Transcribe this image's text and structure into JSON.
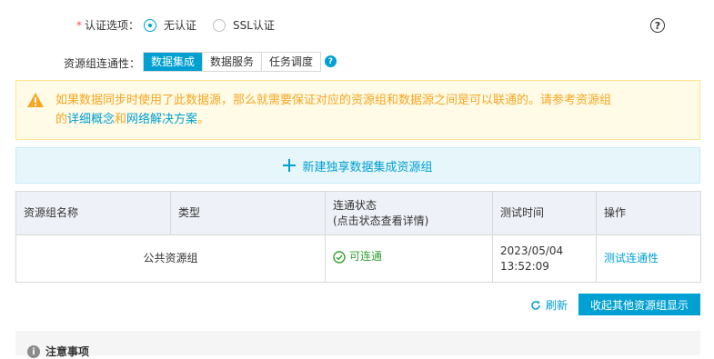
{
  "auth": {
    "required_mark": "*",
    "label": "认证选项：",
    "options": [
      {
        "label": "无认证",
        "checked": true
      },
      {
        "label": "SSL认证",
        "checked": false
      }
    ],
    "help_icon": "question-circle-icon",
    "help_glyph": "?"
  },
  "connectivity": {
    "label": "资源组连通性：",
    "tabs": [
      {
        "label": "数据集成",
        "active": true
      },
      {
        "label": "数据服务",
        "active": false
      },
      {
        "label": "任务调度",
        "active": false
      }
    ],
    "help_glyph": "?"
  },
  "warning": {
    "icon": "warning-triangle-icon",
    "text_main": "如果数据同步时使用了此数据源，那么就需要保证对应的资源组和数据源之间是可以联通的。请参考资源组",
    "text_prefix": "的",
    "link1": "详细概念",
    "text_and": "和",
    "link2": "网络解决方案",
    "text_end": "。"
  },
  "new_group": {
    "icon": "plus-icon",
    "label": "新建独享数据集成资源组"
  },
  "table": {
    "headers": {
      "name": "资源组名称",
      "type": "类型",
      "status_line1": "连通状态",
      "status_line2": "(点击状态查看详情)",
      "time": "测试时间",
      "action": "操作"
    },
    "rows": [
      {
        "name": "公共资源组",
        "type": "",
        "status": "可连通",
        "time_date": "2023/05/04",
        "time_clock": "13:52:09",
        "action": "测试连通性"
      }
    ]
  },
  "footer": {
    "refresh_label": "刷新",
    "collapse_label": "收起其他资源组显示"
  },
  "notice": {
    "icon": "info-icon",
    "info_glyph": "i",
    "title": "注意事项"
  },
  "colors": {
    "accent": "#00a0d2",
    "warning": "#f5a623",
    "success": "#33a02c"
  }
}
